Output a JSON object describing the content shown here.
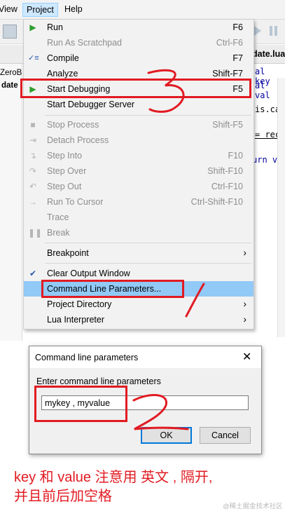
{
  "menubar": {
    "items": [
      "View",
      "Project",
      "Help"
    ]
  },
  "tab": {
    "filename": "date.lua"
  },
  "side_panel": {
    "lines": [
      "ZeroB",
      "date"
    ]
  },
  "code_fragments": [
    "al key",
    "al val",
    "is.cal",
    "= rec",
    "urn va"
  ],
  "project_menu": {
    "items": [
      {
        "label": "Run",
        "shortcut": "F6",
        "icon": "run-icon",
        "disabled": false
      },
      {
        "label": "Run As Scratchpad",
        "shortcut": "Ctrl-F6",
        "icon": "",
        "disabled": true
      },
      {
        "label": "Compile",
        "shortcut": "F7",
        "icon": "compile-icon",
        "disabled": false
      },
      {
        "label": "Analyze",
        "shortcut": "Shift-F7",
        "icon": "",
        "disabled": false
      },
      {
        "label": "Start Debugging",
        "shortcut": "F5",
        "icon": "start-debugging-icon",
        "disabled": false
      },
      {
        "label": "Start Debugger Server",
        "shortcut": "",
        "icon": "",
        "disabled": false
      },
      {
        "label": "Stop Process",
        "shortcut": "Shift-F5",
        "icon": "stop-icon",
        "disabled": true
      },
      {
        "label": "Detach Process",
        "shortcut": "",
        "icon": "detach-icon",
        "disabled": true
      },
      {
        "label": "Step Into",
        "shortcut": "F10",
        "icon": "step-into-icon",
        "disabled": true
      },
      {
        "label": "Step Over",
        "shortcut": "Shift-F10",
        "icon": "step-over-icon",
        "disabled": true
      },
      {
        "label": "Step Out",
        "shortcut": "Ctrl-F10",
        "icon": "step-out-icon",
        "disabled": true
      },
      {
        "label": "Run To Cursor",
        "shortcut": "Ctrl-Shift-F10",
        "icon": "run-to-cursor-icon",
        "disabled": true
      },
      {
        "label": "Trace",
        "shortcut": "",
        "icon": "",
        "disabled": true
      },
      {
        "label": "Break",
        "shortcut": "",
        "icon": "pause-icon",
        "disabled": true
      },
      {
        "label": "Breakpoint",
        "shortcut": "",
        "icon": "",
        "disabled": false,
        "submenu": true
      },
      {
        "label": "Clear Output Window",
        "shortcut": "",
        "icon": "check-icon",
        "disabled": false
      },
      {
        "label": "Command Line Parameters...",
        "shortcut": "",
        "icon": "",
        "disabled": false,
        "highlighted": true
      },
      {
        "label": "Project Directory",
        "shortcut": "",
        "icon": "",
        "disabled": false,
        "submenu": true
      },
      {
        "label": "Lua Interpreter",
        "shortcut": "",
        "icon": "",
        "disabled": false,
        "submenu": true
      }
    ]
  },
  "dialog": {
    "title": "Command line parameters",
    "prompt": "Enter command line parameters",
    "input_value": "mykey , myvalue",
    "ok_label": "OK",
    "cancel_label": "Cancel"
  },
  "annotations": {
    "line1": "key 和 value 注意用 英文 , 隔开,",
    "line2": "并且前后加空格",
    "marks": [
      "3",
      "1",
      "2"
    ],
    "watermark": "@稀土掘金技术社区",
    "color": "#e11b22"
  }
}
